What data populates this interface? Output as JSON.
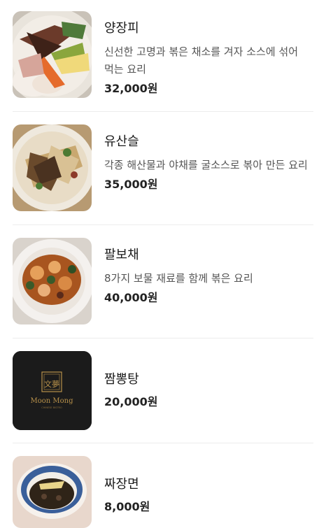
{
  "menu": {
    "items": [
      {
        "name": "양장피",
        "description": "신선한 고명과 볶은 채소를 겨자 소스에 섞어 먹는 요리",
        "price": "32,000원",
        "image": "yangjangpi-photo"
      },
      {
        "name": "유산슬",
        "description": "각종 해산물과 야채를 굴소스로 볶아 만든 요리",
        "price": "35,000원",
        "image": "yusanseul-photo"
      },
      {
        "name": "팔보채",
        "description": "8가지 보물 재료를 함께 볶은 요리",
        "price": "40,000원",
        "image": "palbochae-photo"
      },
      {
        "name": "짬뽕탕",
        "description": "",
        "price": "20,000원",
        "image": "moon-mong-logo"
      },
      {
        "name": "짜장면",
        "description": "",
        "price": "8,000원",
        "image": "jajangmyeon-photo"
      }
    ],
    "logo": {
      "brand": "Moon Mong",
      "subtitle": "CHINESE BISTRO",
      "emblem": "文夢"
    }
  }
}
